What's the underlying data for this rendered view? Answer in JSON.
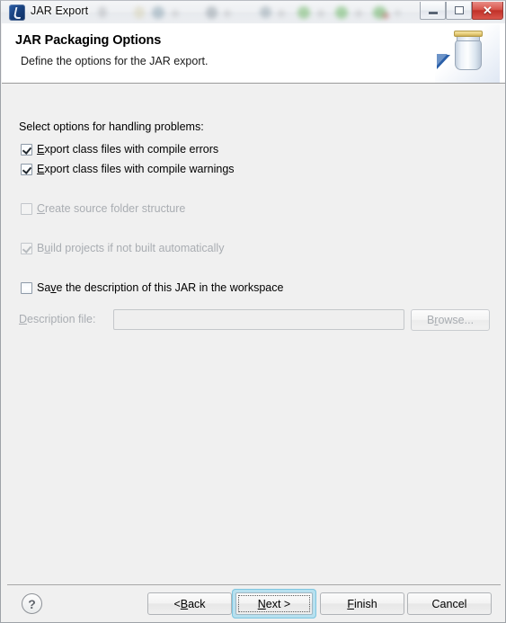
{
  "window": {
    "title": "JAR Export",
    "app_icon": "jar-export-icon",
    "controls": {
      "minimize": "minimize-button",
      "maximize": "maximize-button",
      "close": "close-button",
      "close_glyph": "✕"
    }
  },
  "header": {
    "title": "JAR Packaging Options",
    "description": "Define the options for the JAR export.",
    "graphic": "jar-wizard-banner-icon"
  },
  "main": {
    "section_label": "Select options for handling problems:",
    "options": [
      {
        "label_prefix": "",
        "mnemonic": "E",
        "label_suffix": "xport class files with compile errors",
        "checked": true,
        "enabled": true,
        "name": "checkbox-export-class-files-with-compile-errors"
      },
      {
        "label_prefix": "",
        "mnemonic": "E",
        "label_suffix": "xport class files with compile warnings",
        "checked": true,
        "enabled": true,
        "name": "checkbox-export-class-files-with-compile-warnings"
      },
      {
        "label_prefix": "",
        "mnemonic": "C",
        "label_suffix": "reate source folder structure",
        "checked": false,
        "enabled": false,
        "name": "checkbox-create-source-folder-structure"
      },
      {
        "label_prefix": "B",
        "mnemonic": "u",
        "label_suffix": "ild projects if not built automatically",
        "checked": true,
        "enabled": false,
        "name": "checkbox-build-projects-if-not-built-automatically"
      },
      {
        "label_prefix": "Sa",
        "mnemonic": "v",
        "label_suffix": "e the description of this JAR in the workspace",
        "checked": false,
        "enabled": true,
        "name": "checkbox-save-description-in-workspace"
      }
    ],
    "description_file": {
      "label_prefix": "",
      "label_mnemonic": "D",
      "label_suffix": "escription file:",
      "value": "",
      "placeholder": "",
      "enabled": false,
      "browse_prefix": "B",
      "browse_mnemonic": "r",
      "browse_suffix": "owse..."
    }
  },
  "footer": {
    "help_glyph": "?",
    "buttons": [
      {
        "prefix": "< ",
        "mnemonic": "B",
        "suffix": "ack",
        "focused": false,
        "name": "back-button"
      },
      {
        "prefix": "",
        "mnemonic": "N",
        "suffix": "ext >",
        "focused": true,
        "name": "next-button"
      },
      {
        "prefix": "",
        "mnemonic": "F",
        "suffix": "inish",
        "focused": false,
        "name": "finish-button"
      },
      {
        "prefix": "Cancel",
        "mnemonic": "",
        "suffix": "",
        "focused": false,
        "name": "cancel-button"
      }
    ]
  },
  "colors": {
    "dialog_bg": "#f0f0f0",
    "header_bg": "#ffffff",
    "focus_glow": "#b7e0ef",
    "disabled_text": "#a9adb2",
    "close_button": "#c13128"
  }
}
